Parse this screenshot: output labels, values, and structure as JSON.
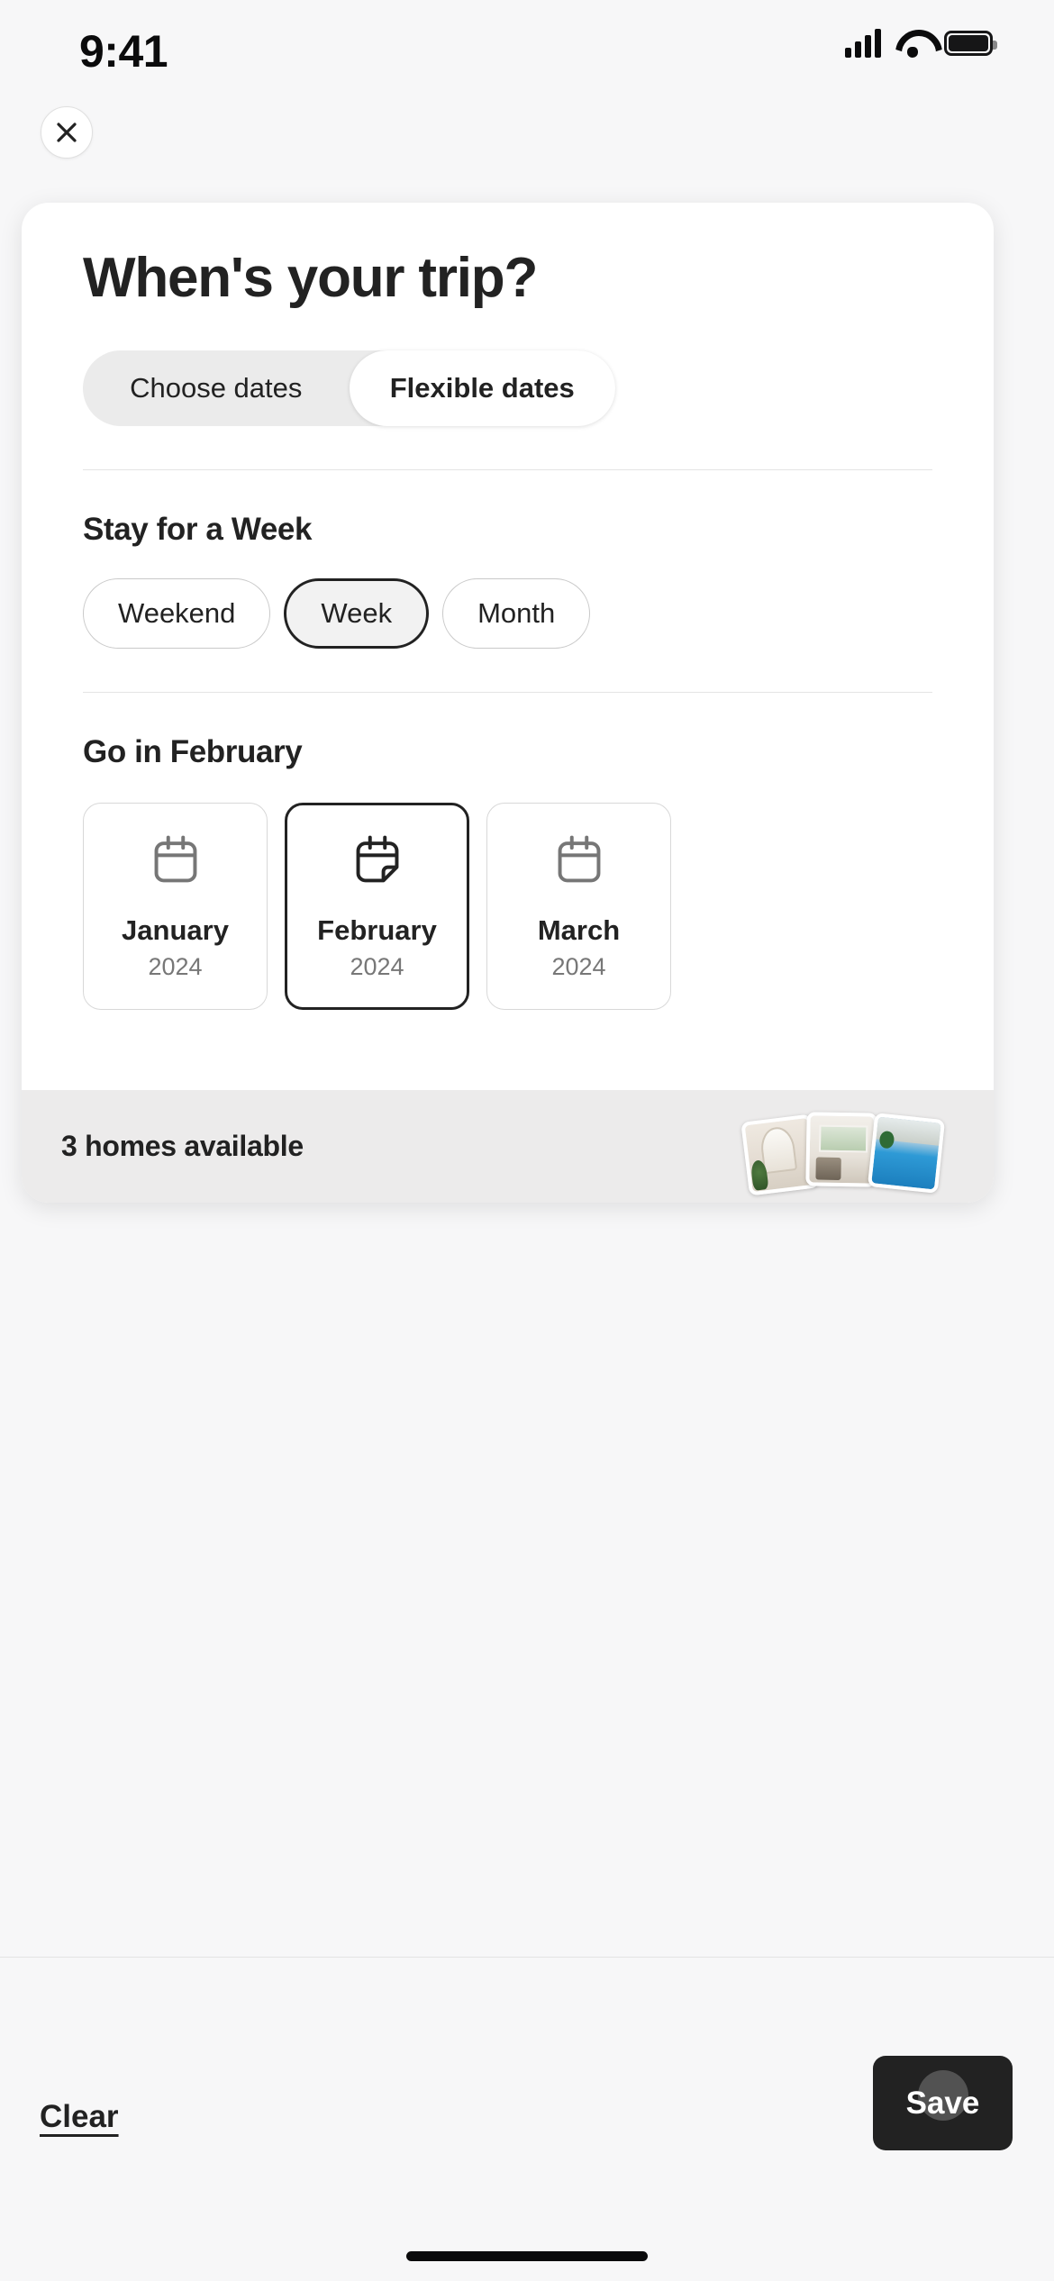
{
  "status_bar": {
    "time": "9:41",
    "cellular_icon": "cellular-signal-icon",
    "wifi_icon": "wifi-icon",
    "battery_icon": "battery-full-icon"
  },
  "header": {
    "close_icon": "close-icon"
  },
  "modal": {
    "title": "When's your trip?",
    "tabs": [
      {
        "label": "Choose dates",
        "selected": false
      },
      {
        "label": "Flexible dates",
        "selected": true
      }
    ],
    "duration_section": {
      "heading": "Stay for a Week",
      "options": [
        {
          "label": "Weekend",
          "selected": false
        },
        {
          "label": "Week",
          "selected": true
        },
        {
          "label": "Month",
          "selected": false
        }
      ]
    },
    "month_section": {
      "heading": "Go in February",
      "months": [
        {
          "name": "January",
          "year": "2024",
          "icon": "calendar-icon",
          "selected": false
        },
        {
          "name": "February",
          "year": "2024",
          "icon": "calendar-folded-corner-icon",
          "selected": true
        },
        {
          "name": "March",
          "year": "2024",
          "icon": "calendar-icon",
          "selected": false
        }
      ]
    },
    "results_bar": {
      "text": "3 homes available",
      "thumbnails": [
        {
          "name": "thumbnail-arched-interior"
        },
        {
          "name": "thumbnail-living-room"
        },
        {
          "name": "thumbnail-pool-villa"
        }
      ]
    }
  },
  "footer": {
    "clear_label": "Clear",
    "save_label": "Save"
  },
  "colors": {
    "background": "#F7F7F8",
    "card": "#FFFFFF",
    "text_primary": "#222222",
    "text_secondary": "#777777",
    "segment_track": "#EBEBEB",
    "results_bar": "#ECEBEB",
    "save_button": "#222222"
  }
}
